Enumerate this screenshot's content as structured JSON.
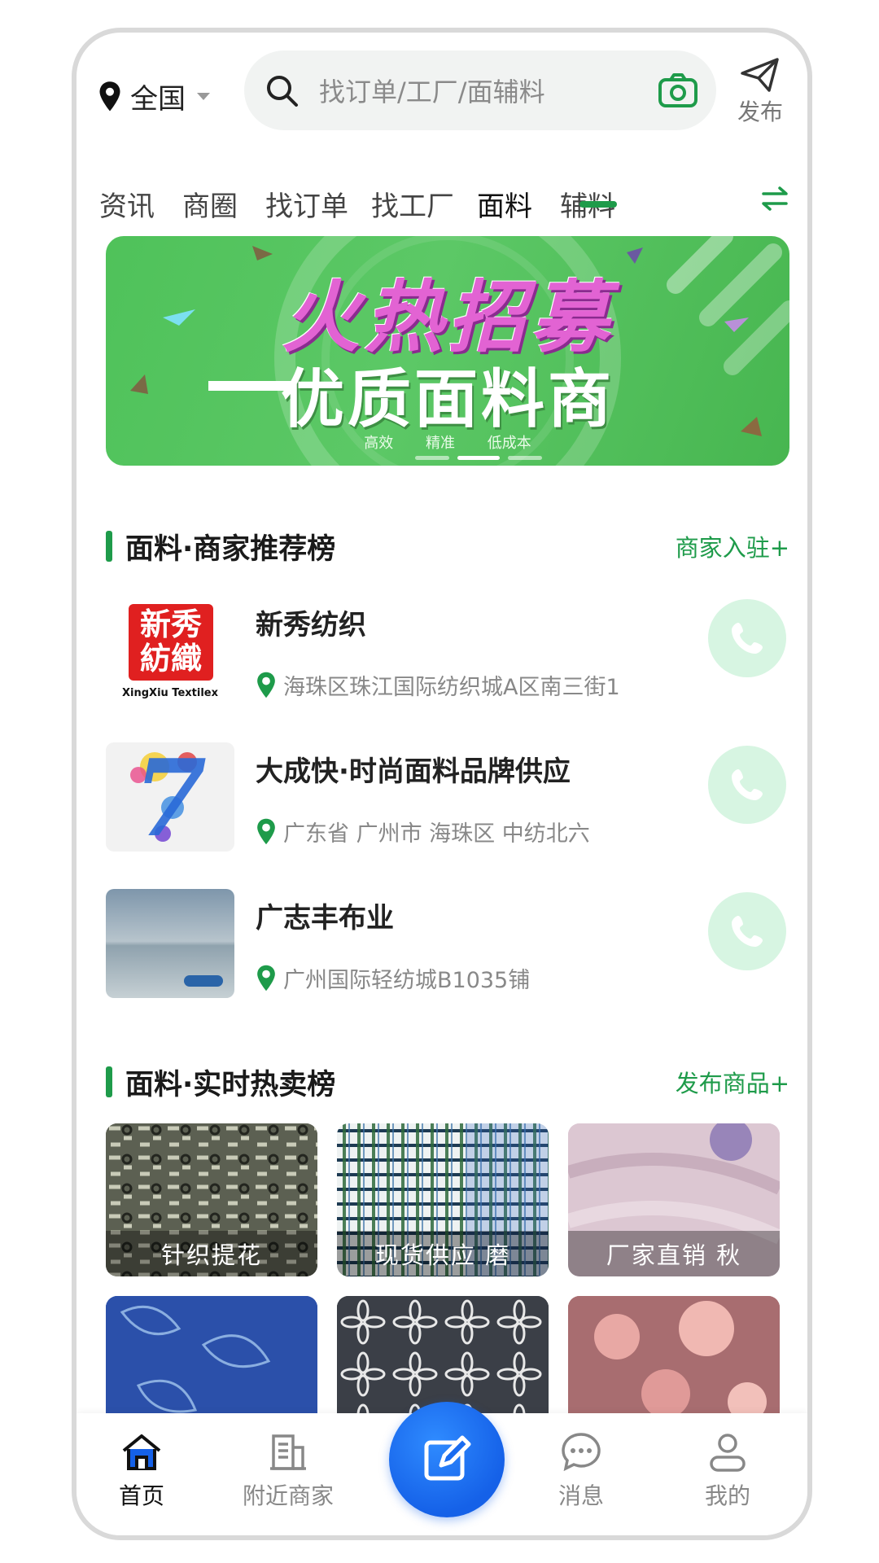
{
  "top": {
    "location": "全国",
    "search_placeholder": "找订单/工厂/面辅料",
    "publish_label": "发布"
  },
  "tabs": [
    {
      "label": "资讯"
    },
    {
      "label": "商圈"
    },
    {
      "label": "找订单"
    },
    {
      "label": "找工厂"
    },
    {
      "label": "面料",
      "active": true
    },
    {
      "label": "辅料"
    }
  ],
  "banner": {
    "title": "火热招募",
    "subtitle": "优质面料商",
    "tags": "高效 精准 低成本",
    "slide": "2 of 3"
  },
  "merchants_section": {
    "title": "面料·商家推荐榜",
    "link": "商家入驻+",
    "items": [
      {
        "name": "新秀纺织",
        "address": "海珠区珠江国际纺织城A区南三街1",
        "logo_text_top": "新秀",
        "logo_text_bottom": "紡織",
        "logo_caption": "XingXiu Textilex"
      },
      {
        "name": "大成快·时尚面料品牌供应",
        "address": "广东省 广州市 海珠区 中纺北六",
        "logo_glyph": "7"
      },
      {
        "name": "广志丰布业",
        "address": "广州国际轻纺城B1035铺"
      }
    ]
  },
  "products_section": {
    "title": "面料·实时热卖榜",
    "link": "发布商品+",
    "items": [
      {
        "label": "针织提花"
      },
      {
        "label": "现货供应 磨"
      },
      {
        "label": "厂家直销 秋"
      },
      {
        "label": ""
      },
      {
        "label": ""
      },
      {
        "label": ""
      }
    ]
  },
  "bottom_nav": {
    "home": "首页",
    "nearby": "附近商家",
    "messages": "消息",
    "me": "我的"
  },
  "colors": {
    "accent": "#1e9b4a",
    "banner_green": "#4fc25a",
    "fab_blue": "#1561e8",
    "call_bg": "#d7f5e2"
  },
  "icons": [
    "location-pin-icon",
    "search-icon",
    "camera-icon",
    "send-icon",
    "swap-icon",
    "phone-icon",
    "home-icon",
    "building-icon",
    "edit-icon",
    "chat-icon",
    "user-icon"
  ]
}
